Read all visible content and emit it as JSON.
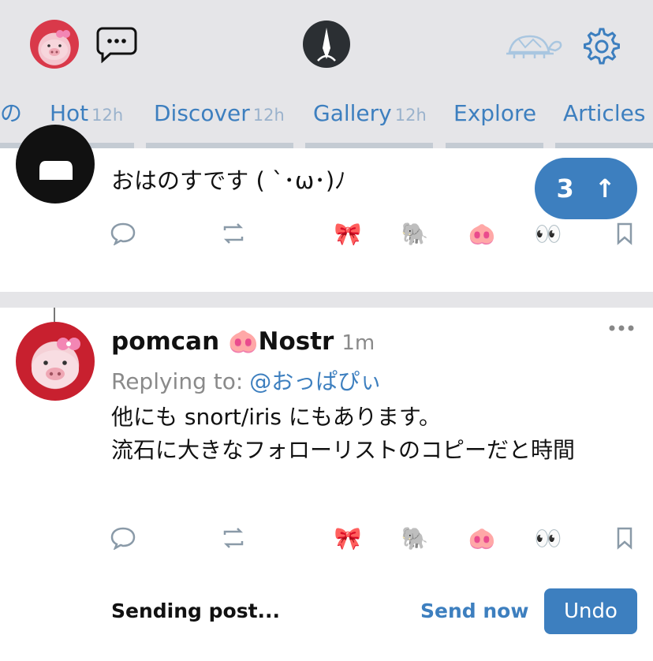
{
  "header": {
    "icons": [
      "profile-avatar",
      "messages-icon",
      "app-logo",
      "turtle-icon",
      "settings-gear-icon"
    ]
  },
  "tabs": [
    {
      "label": "の",
      "sub": ""
    },
    {
      "label": "Hot",
      "sub": "12h"
    },
    {
      "label": "Discover",
      "sub": "12h"
    },
    {
      "label": "Gallery",
      "sub": "12h"
    },
    {
      "label": "Explore",
      "sub": ""
    },
    {
      "label": "Articles",
      "sub": ""
    }
  ],
  "new_posts": {
    "count": "3",
    "arrow": "↑"
  },
  "post1": {
    "text": "おはのすです ( ˋ･ω･)ﾉ",
    "reactions": [
      "🎀",
      "🐘",
      "🐽",
      "👀"
    ]
  },
  "post2": {
    "author": "pomcan 🐽Nostr",
    "time": "1m",
    "replying_label": "Replying to:",
    "replying_to": "@おっぱぴぃ",
    "body_line1": "他にも snort/iris にもあります。",
    "body_line2": "流石に大きなフォローリストのコピーだと時間",
    "reactions": [
      "🎀",
      "🐘",
      "🐽",
      "👀"
    ]
  },
  "sending_bar": {
    "status": "Sending post...",
    "send_now": "Send now",
    "undo": "Undo"
  },
  "colors": {
    "accent": "#3d7fbf",
    "header_bg": "#e5e5e8"
  }
}
